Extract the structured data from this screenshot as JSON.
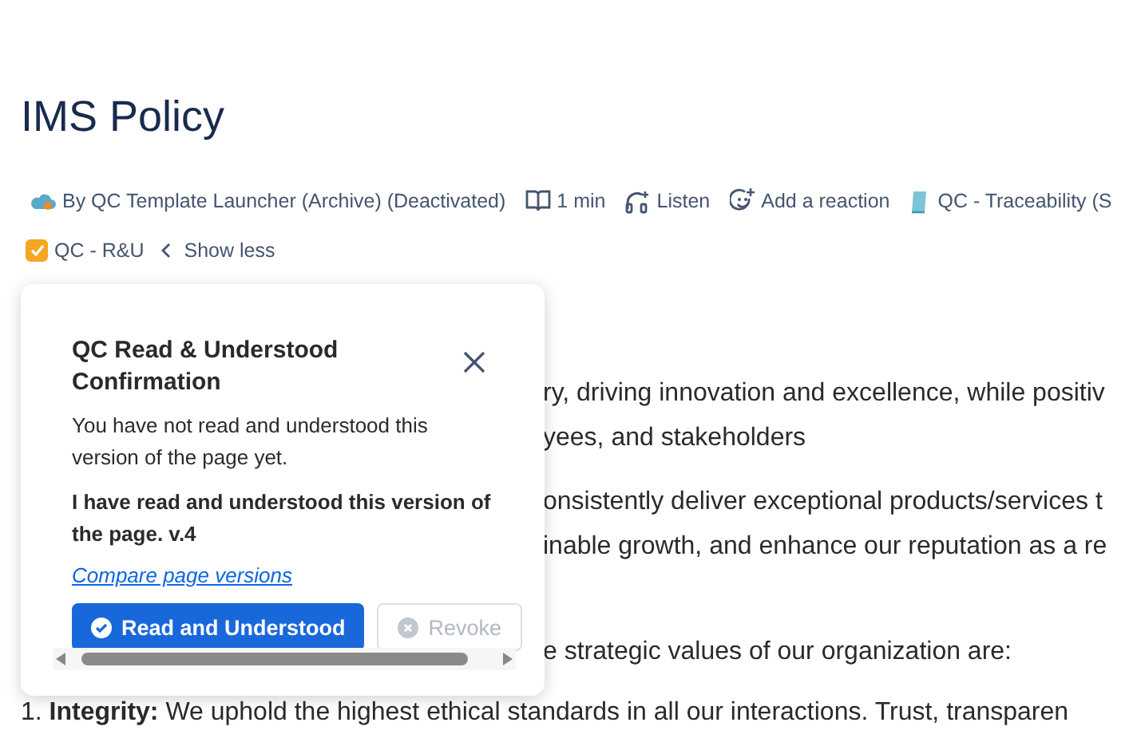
{
  "page": {
    "title": "IMS Policy"
  },
  "meta": [
    {
      "kind": "author",
      "label": "By QC Template Launcher (Archive) (Deactivated)"
    },
    {
      "kind": "read_time",
      "label": "1 min"
    },
    {
      "kind": "listen",
      "label": "Listen"
    },
    {
      "kind": "reaction",
      "label": "Add a reaction"
    },
    {
      "kind": "tag",
      "label": "QC - Traceability (S"
    }
  ],
  "tags": [
    {
      "label": "QC - R&U",
      "checked": true
    }
  ],
  "show_less": "Show less",
  "paragraphs": [
    [
      "ry, driving innovation and excellence, while positiv",
      "yees, and stakeholders"
    ],
    [
      "onsistently deliver exceptional products/services t",
      "inable growth, and enhance our reputation as a re"
    ],
    [
      "e strategic values of our organization are:"
    ]
  ],
  "list_item": "1. **Integrity:** We uphold the highest ethical standards in all our interactions. Trust, transparen",
  "popup": {
    "title": "QC Read & Understood Confirmation",
    "message": "You have not read and understood this version of the page yet.",
    "statement": "I have read and understood this version of the page. v.4",
    "link": "Compare page versions",
    "buttons": [
      {
        "label": "Read and Understood",
        "kind": "primary",
        "disabled": false
      },
      {
        "label": "Revoke",
        "kind": "secondary",
        "disabled": true
      }
    ]
  }
}
